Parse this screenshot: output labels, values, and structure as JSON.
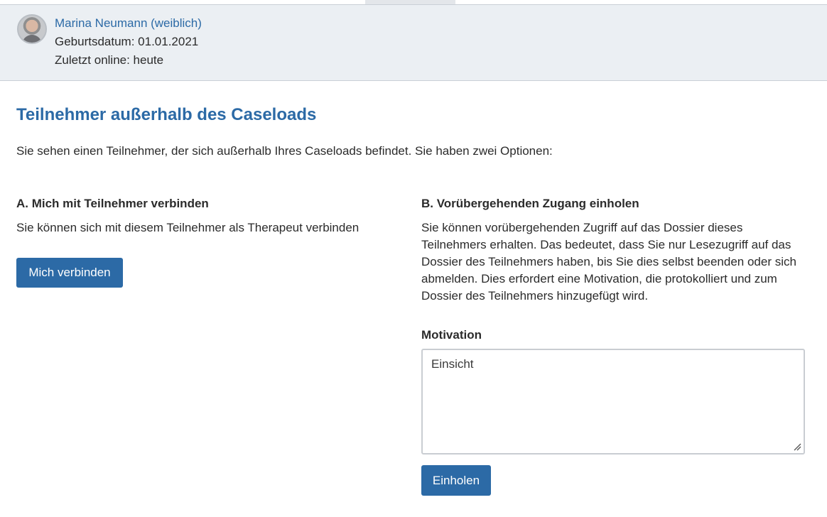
{
  "user": {
    "name": "Marina Neumann (weiblich)",
    "birthdate": "Geburtsdatum: 01.01.2021",
    "last_online": "Zuletzt online: heute"
  },
  "page": {
    "title": "Teilnehmer außerhalb des Caseloads",
    "intro": "Sie sehen einen Teilnehmer, der sich außerhalb Ihres Caseloads befindet. Sie haben zwei Optionen:"
  },
  "option_a": {
    "heading": "A. Mich mit Teilnehmer verbinden",
    "description": "Sie können sich mit diesem Teilnehmer als Therapeut verbinden",
    "button_label": "Mich verbinden"
  },
  "option_b": {
    "heading": "B. Vorübergehenden Zugang einholen",
    "description": "Sie können vorübergehenden Zugriff auf das Dossier dieses Teilnehmers erhalten. Das bedeutet, dass Sie nur Lesezugriff auf das Dossier des Teilnehmers haben, bis Sie dies selbst beenden oder sich abmelden. Dies erfordert eine Motivation, die protokolliert und zum Dossier des Teilnehmers hinzugefügt wird.",
    "motivation_label": "Motivation",
    "motivation_value": "Einsicht",
    "button_label": "Einholen"
  },
  "colors": {
    "accent": "#2c6aa6",
    "header_bg": "#ebeff3",
    "text": "#2b2b2b"
  },
  "icons": {
    "avatar": "user-avatar-photo",
    "resize": "textarea-resize-grip-icon"
  }
}
